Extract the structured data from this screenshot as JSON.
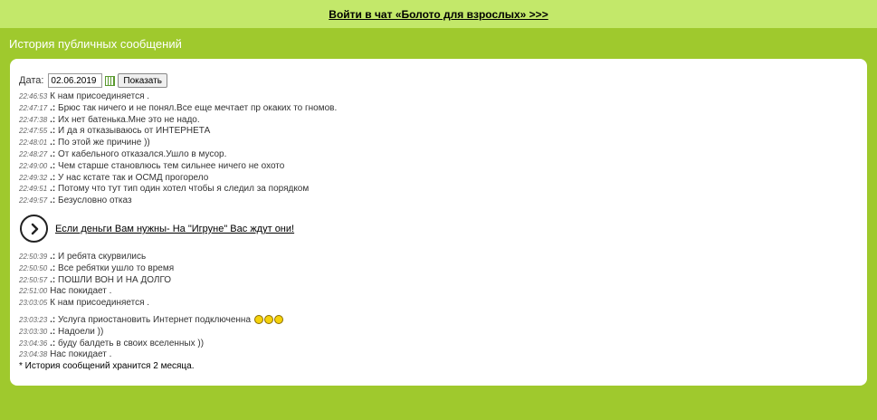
{
  "topbar": {
    "link_text": "Войти в чат «Болото для взрослых» >>>"
  },
  "section": {
    "title": "История публичных сообщений"
  },
  "filter": {
    "date_label": "Дата:",
    "date_value": "02.06.2019",
    "show_button": "Показать"
  },
  "messages_a": [
    {
      "time": "22:46:53",
      "bullet": "",
      "text": "К нам присоединяется ."
    },
    {
      "time": "22:47:17",
      "bullet": ".:",
      "text": "Брюс так ничего и не понял.Все еще мечтает пр окаких то гномов."
    },
    {
      "time": "22:47:38",
      "bullet": ".:",
      "text": "Их нет батенька.Мне это не надо."
    },
    {
      "time": "22:47:55",
      "bullet": ".:",
      "text": "И да я отказываюсь от ИНТЕРНЕТА"
    },
    {
      "time": "22:48:01",
      "bullet": ".:",
      "text": "По этой же причине ))"
    },
    {
      "time": "22:48:27",
      "bullet": ".:",
      "text": "От кабельного отказался.Ушло в мусор."
    },
    {
      "time": "22:49:00",
      "bullet": ".:",
      "text": "Чем старше становлюсь тем сильнее ничего не охото"
    },
    {
      "time": "22:49:32",
      "bullet": ".:",
      "text": "У нас кстате так и ОСМД прогорело"
    },
    {
      "time": "22:49:51",
      "bullet": ".:",
      "text": "Потому что тут тип один хотел чтобы я следил за порядком"
    },
    {
      "time": "22:49:57",
      "bullet": ".:",
      "text": "Безусловно отказ"
    }
  ],
  "ad": {
    "text": "Если деньги Вам нужны- На \"Игруне\" Вас ждут они!"
  },
  "messages_b": [
    {
      "time": "22:50:39",
      "bullet": ".:",
      "text": "И ребята скурвились"
    },
    {
      "time": "22:50:50",
      "bullet": ".:",
      "text": "Все ребятки ушло то время"
    },
    {
      "time": "22:50:57",
      "bullet": ".:",
      "text": "ПОШЛИ ВОН И НА ДОЛГО"
    },
    {
      "time": "22:51:00",
      "bullet": "",
      "text": "Нас покидает ."
    },
    {
      "time": "23:03:05",
      "bullet": "",
      "text": "К нам присоединяется ."
    }
  ],
  "messages_c": [
    {
      "time": "23:03:23",
      "bullet": ".:",
      "text": "Услуга приостановить Интернет подключенна",
      "smiley": true
    },
    {
      "time": "23:03:30",
      "bullet": ".:",
      "text": "Надоели ))"
    },
    {
      "time": "23:04:36",
      "bullet": ".:",
      "text": "буду балдеть в своих вселенных ))"
    },
    {
      "time": "23:04:38",
      "bullet": "",
      "text": "Нас покидает ."
    }
  ],
  "note": "* История сообщений хранится 2 месяца."
}
